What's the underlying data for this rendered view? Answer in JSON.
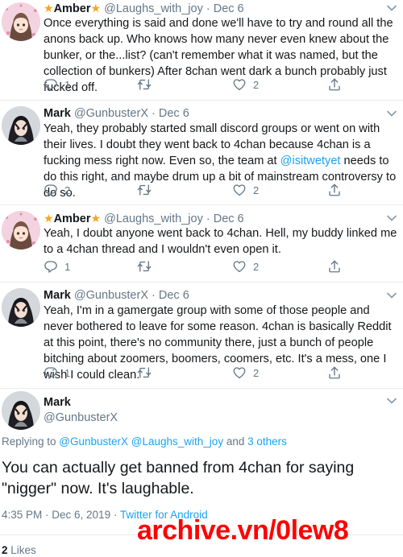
{
  "colors": {
    "link": "#1da1f2",
    "muted": "#657786",
    "text": "#14171a",
    "star": "#f5a524",
    "watermark": "#ff0000"
  },
  "tweets": [
    {
      "name": "Amber",
      "handle": "@Laughs_with_joy",
      "date": "· Dec 6",
      "star": "★",
      "text": "Once everything is said and done we'll have to try and round all the anons back up. Who knows how many never even knew about the bunker, or the...list? (can't remember what it was named, but the collection of bunkers) After 8chan went dark a bunch probably just fucked off.",
      "replies": "1",
      "retweets": "",
      "likes": "2"
    },
    {
      "name": "Mark",
      "handle": "@GunbusterX",
      "date": "· Dec 6",
      "text_before": "Yeah, they probably started small discord groups or went on with their lives. I doubt they went back to 4chan because 4chan is a fucking mess right now. Even so, the team at ",
      "mention": "@isitwetyet",
      "text_after": " needs to do this right, and maybe drum up a bit of mainstream controversy to do so.",
      "replies": "2",
      "retweets": "",
      "likes": "2"
    },
    {
      "name": "Amber",
      "handle": "@Laughs_with_joy",
      "date": "· Dec 6",
      "star": "★",
      "text": "Yeah, I doubt anyone went back to 4chan. Hell, my buddy linked me to a 4chan thread and I wouldn't even open it.",
      "replies": "1",
      "retweets": "",
      "likes": "2"
    },
    {
      "name": "Mark",
      "handle": "@GunbusterX",
      "date": "· Dec 6",
      "text": "Yeah, I'm in a gamergate group with some of those people and never bothered to leave for some reason. 4chan is basically Reddit at this point, there's no community there, just a bunch of people bitching about zoomers, boomers, coomers, etc. It's a mess, one I wish I could clean.",
      "replies": "1",
      "retweets": "",
      "likes": "2"
    }
  ],
  "main_tweet": {
    "name": "Mark",
    "handle": "@GunbusterX",
    "replying_prefix": "Replying to ",
    "replying_to": "@GunbusterX @Laughs_with_joy",
    "replying_and": " and ",
    "replying_others": "3 others",
    "text": "You can actually get banned from 4chan for saying \"nigger\" now. It's laughable.",
    "timestamp": "4:35 PM · Dec 6, 2019 · ",
    "client": "Twitter for Android",
    "likes_count": "2",
    "likes_label": " Likes"
  },
  "watermark": "archive.vn/0lew8",
  "icons": [
    "reply-icon",
    "retweet-icon",
    "like-icon",
    "share-icon",
    "caret-down-icon",
    "star-icon"
  ]
}
